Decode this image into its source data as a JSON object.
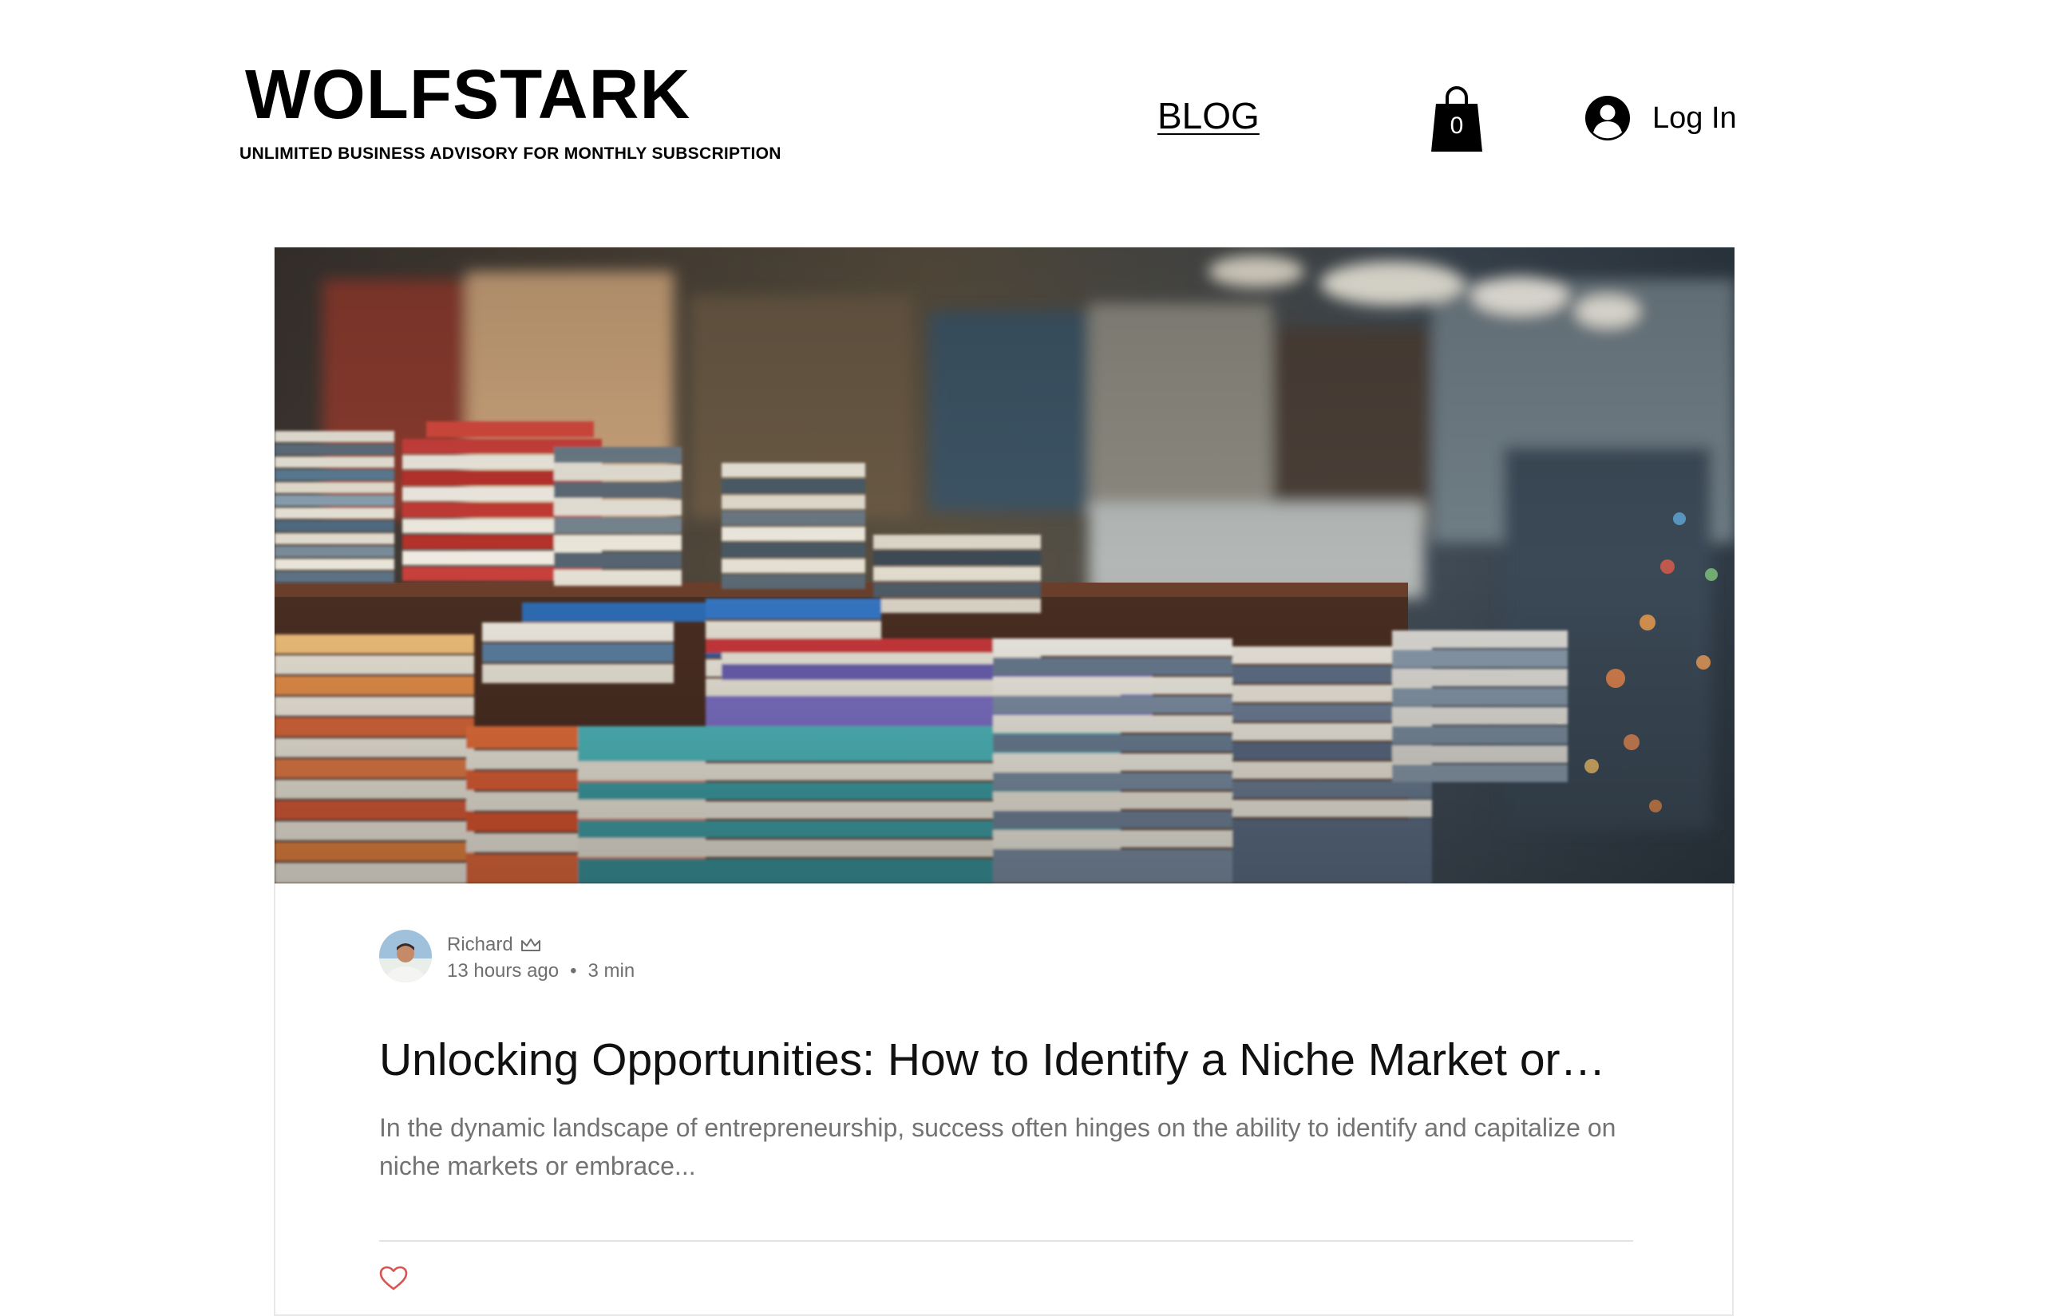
{
  "header": {
    "brand_title": "WOLFSTARK",
    "tagline": "UNLIMITED BUSINESS ADVISORY FOR MONTHLY SUBSCRIPTION",
    "nav": {
      "blog_label": "BLOG"
    },
    "cart": {
      "count": "0",
      "icon": "shopping-bag-icon"
    },
    "login": {
      "label": "Log In",
      "icon": "user-avatar-icon"
    }
  },
  "post": {
    "cover_image": "bookstore-books-photo",
    "author": {
      "name": "Richard",
      "badge_icon": "crown-icon"
    },
    "published": "13 hours ago",
    "separator": "•",
    "read_time": "3 min",
    "title": "Unlocking Opportunities: How to Identify a Niche Market or…",
    "excerpt": "In the dynamic landscape of entrepreneurship, success often hinges on the ability to identify and capitalize on niche markets or embrace...",
    "like_icon": "heart-icon"
  },
  "colors": {
    "text": "#000000",
    "meta_text": "#6f6f6f",
    "excerpt_text": "#737373",
    "divider": "#e3e3e3",
    "like_heart": "#d9534f"
  }
}
